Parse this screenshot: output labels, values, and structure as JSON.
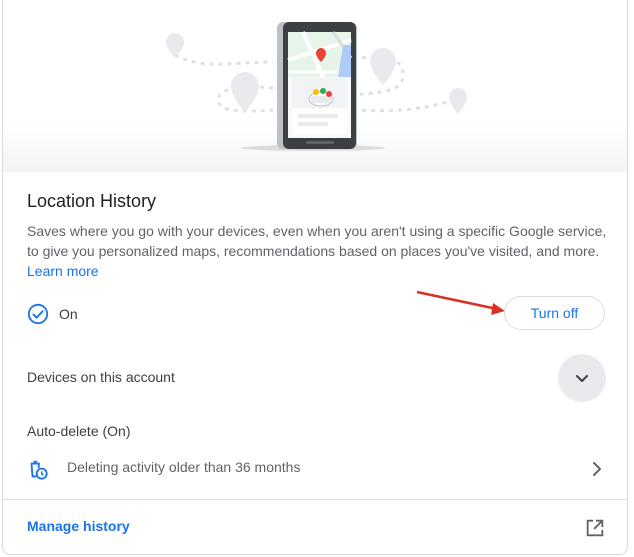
{
  "card": {
    "title": "Location History",
    "description": "Saves where you go with your devices, even when you aren't using a specific Google service, to give you personalized maps, recommendations based on places you've visited, and more. ",
    "learn_more": "Learn more"
  },
  "status": {
    "icon": "check-circle-icon",
    "text": "On",
    "turn_off_label": "Turn off"
  },
  "devices": {
    "label": "Devices on this account",
    "expand_icon": "chevron-down-icon"
  },
  "auto_delete": {
    "title": "Auto-delete (On)",
    "icon": "trash-clock-icon",
    "text": "Deleting activity older than 36 months",
    "chevron_icon": "chevron-right-icon"
  },
  "footer": {
    "manage_label": "Manage history",
    "open_icon": "open-in-new-icon"
  },
  "colors": {
    "accent": "#1a73e8",
    "arrow": "#d93025",
    "text": "#3c4043",
    "secondary_text": "#5f6368",
    "divider": "#dadce0"
  }
}
